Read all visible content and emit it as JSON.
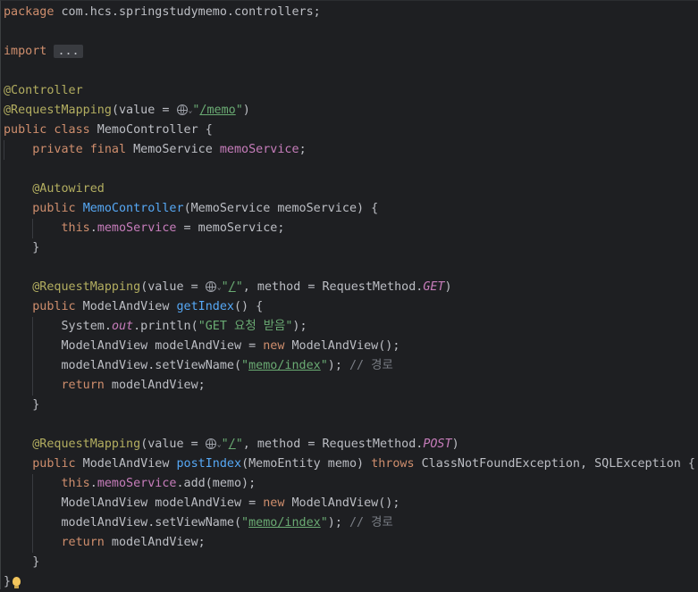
{
  "editor": {
    "lines": {
      "l1": {
        "kw": "package",
        "rest": " com.hcs.springstudymemo.controllers;"
      },
      "l3": {
        "kw": "import",
        "fold": "..."
      },
      "l5": {
        "ann": "@Controller"
      },
      "l6": {
        "ann": "@RequestMapping",
        "pre": "(value = ",
        "q1": "\"",
        "url": "/memo",
        "q2": "\"",
        "post": ")"
      },
      "l7": {
        "kw": "public class",
        "rest": " MemoController {"
      },
      "l8": {
        "kw": "private final",
        "type": " MemoService ",
        "fld": "memoService",
        "post": ";"
      },
      "l10": {
        "ann": "@Autowired"
      },
      "l11": {
        "kw": "public",
        "fn": "MemoController",
        "rest": "(MemoService memoService) {"
      },
      "l12": {
        "kw": "this",
        "dot": ".",
        "fld": "memoService",
        "rest": " = memoService;"
      },
      "l13": {
        "text": "}"
      },
      "l15": {
        "ann": "@RequestMapping",
        "pre": "(value = ",
        "q1": "\"",
        "url": "/",
        "q2": "\"",
        "mid": ", method = RequestMethod.",
        "itl": "GET",
        "post": ")"
      },
      "l16": {
        "kw": "public",
        "type": " ModelAndView ",
        "fn": "getIndex",
        "rest": "() {"
      },
      "l17": {
        "pre": "System.",
        "itl": "out",
        "mid": ".println(",
        "str": "\"GET 요청 받음\"",
        "post": ");"
      },
      "l18": {
        "pre": "ModelAndView modelAndView = ",
        "kw": "new",
        "post": " ModelAndView();"
      },
      "l19": {
        "pre": "modelAndView.setViewName(",
        "q1": "\"",
        "url": "memo/index",
        "q2": "\"",
        "post": "); ",
        "cmt": "// 경로"
      },
      "l20": {
        "kw": "return",
        "rest": " modelAndView;"
      },
      "l21": {
        "text": "}"
      },
      "l23": {
        "ann": "@RequestMapping",
        "pre": "(value = ",
        "q1": "\"",
        "url": "/",
        "q2": "\"",
        "mid": ", method = RequestMethod.",
        "itl": "POST",
        "post": ")"
      },
      "l24": {
        "kw": "public",
        "type": " ModelAndView ",
        "fn": "postIndex",
        "mid": "(MemoEntity memo) ",
        "kw2": "throws",
        "rest": " ClassNotFoundException, SQLException {"
      },
      "l25": {
        "kw": "this",
        "dot": ".",
        "fld": "memoService",
        "rest": ".add(memo);"
      },
      "l26": {
        "pre": "ModelAndView modelAndView = ",
        "kw": "new",
        "post": " ModelAndView();"
      },
      "l27": {
        "pre": "modelAndView.setViewName(",
        "q1": "\"",
        "url": "memo/index",
        "q2": "\"",
        "post": "); ",
        "cmt": "// 경로"
      },
      "l28": {
        "kw": "return",
        "rest": " modelAndView;"
      },
      "l29": {
        "text": "}"
      },
      "l30": {
        "text": "}"
      }
    },
    "icons": {
      "web_link": "globe-icon",
      "dropdown": "chevron-down-icon",
      "intention": "lightbulb-icon"
    },
    "colors": {
      "background": "#1e1f22",
      "keyword": "#cf8e6d",
      "annotation": "#b3ae60",
      "function": "#56a8f5",
      "field": "#c77dbb",
      "string": "#6aab73",
      "comment": "#7a7e85",
      "text": "#bcbec4"
    }
  }
}
